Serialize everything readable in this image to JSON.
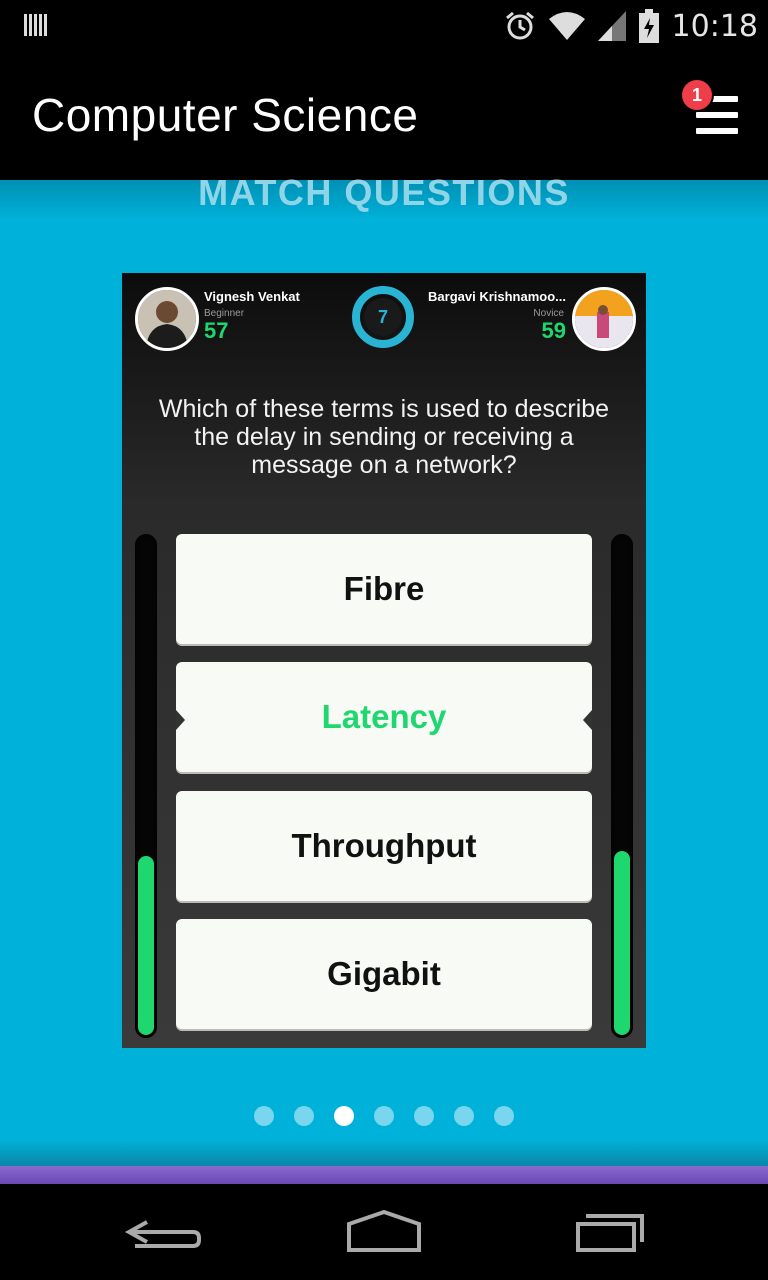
{
  "status_bar": {
    "time": "10:18",
    "icons": [
      "barcode-icon",
      "alarm-icon",
      "wifi-icon",
      "signal-icon",
      "battery-icon"
    ]
  },
  "app_bar": {
    "title": "Computer Science",
    "menu_icon": "hamburger-menu-icon",
    "notification_count": "1"
  },
  "section": {
    "title": "MATCH QUESTIONS"
  },
  "match": {
    "player_left": {
      "name": "Vignesh Venkat",
      "level": "Beginner",
      "score": "57"
    },
    "player_right": {
      "name": "Bargavi Krishnamoo...",
      "level": "Novice",
      "score": "59"
    },
    "timer": "7",
    "question": "Which of these terms is used to describe the delay in sending or receiving a message on a network?",
    "answers": [
      "Fibre",
      "Latency",
      "Throughput",
      "Gigabit"
    ],
    "correct_answer_index": 1,
    "left_progress": 0.36,
    "right_progress": 0.37
  },
  "pager": {
    "count": 7,
    "active_index": 2
  },
  "colors": {
    "background": "#00b1d9",
    "accent_green": "#1ed86f",
    "timer_blue": "#29b4d4",
    "badge_red": "#ef3e4a"
  },
  "nav_bar": {
    "buttons": [
      "back-icon",
      "home-icon",
      "recent-apps-icon"
    ]
  }
}
